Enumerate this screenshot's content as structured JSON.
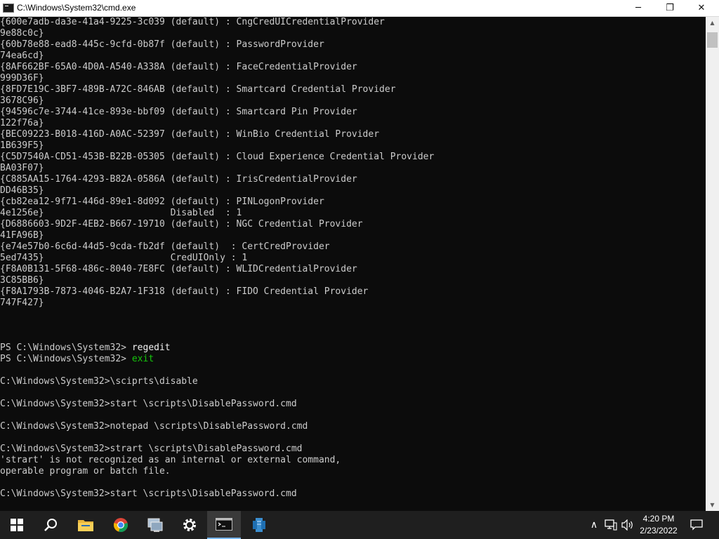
{
  "window": {
    "title": "C:\\Windows\\System32\\cmd.exe",
    "minimize_glyph": "─",
    "maximize_glyph": "❐",
    "close_glyph": "✕"
  },
  "console": {
    "lines": [
      {
        "text": "{600e7adb-da3e-41a4-9225-3c039 (default) : CngCredUICredentialProvider"
      },
      {
        "text": "9e88c0c}"
      },
      {
        "text": "{60b78e88-ead8-445c-9cfd-0b87f (default) : PasswordProvider"
      },
      {
        "text": "74ea6cd}"
      },
      {
        "text": "{8AF662BF-65A0-4D0A-A540-A338A (default) : FaceCredentialProvider"
      },
      {
        "text": "999D36F}"
      },
      {
        "text": "{8FD7E19C-3BF7-489B-A72C-846AB (default) : Smartcard Credential Provider"
      },
      {
        "text": "3678C96}"
      },
      {
        "text": "{94596c7e-3744-41ce-893e-bbf09 (default) : Smartcard Pin Provider"
      },
      {
        "text": "122f76a}"
      },
      {
        "text": "{BEC09223-B018-416D-A0AC-52397 (default) : WinBio Credential Provider"
      },
      {
        "text": "1B639F5}"
      },
      {
        "text": "{C5D7540A-CD51-453B-B22B-05305 (default) : Cloud Experience Credential Provider"
      },
      {
        "text": "BA03F07}"
      },
      {
        "text": "{C885AA15-1764-4293-B82A-0586A (default) : IrisCredentialProvider"
      },
      {
        "text": "DD46B35}"
      },
      {
        "text": "{cb82ea12-9f71-446d-89e1-8d092 (default) : PINLogonProvider"
      },
      {
        "text": "4e1256e}                       Disabled  : 1"
      },
      {
        "text": "{D6886603-9D2F-4EB2-B667-19710 (default) : NGC Credential Provider"
      },
      {
        "text": "41FA96B}"
      },
      {
        "text": "{e74e57b0-6c6d-44d5-9cda-fb2df (default)  : CertCredProvider"
      },
      {
        "text": "5ed7435}                       CredUIOnly : 1"
      },
      {
        "text": "{F8A0B131-5F68-486c-8040-7E8FC (default) : WLIDCredentialProvider"
      },
      {
        "text": "3C85BB6}"
      },
      {
        "text": "{F8A1793B-7873-4046-B2A7-1F318 (default) : FIDO Credential Provider"
      },
      {
        "text": "747F427}"
      },
      {
        "text": ""
      },
      {
        "text": ""
      },
      {
        "text": ""
      },
      {
        "text": "PS C:\\Windows\\System32> ",
        "cmd": "regedit"
      },
      {
        "text": "PS C:\\Windows\\System32> ",
        "exit": "exit"
      },
      {
        "text": ""
      },
      {
        "text": "C:\\Windows\\System32>\\sciprts\\disable"
      },
      {
        "text": ""
      },
      {
        "text": "C:\\Windows\\System32>start \\scripts\\DisablePassword.cmd"
      },
      {
        "text": ""
      },
      {
        "text": "C:\\Windows\\System32>notepad \\scripts\\DisablePassword.cmd"
      },
      {
        "text": ""
      },
      {
        "text": "C:\\Windows\\System32>strart \\scripts\\DisablePassword.cmd"
      },
      {
        "text": "'strart' is not recognized as an internal or external command,"
      },
      {
        "text": "operable program or batch file."
      },
      {
        "text": ""
      },
      {
        "text": "C:\\Windows\\System32>start \\scripts\\DisablePassword.cmd"
      },
      {
        "text": ""
      },
      {
        "text": "C:\\Windows\\System32>"
      }
    ]
  },
  "taskbar": {
    "apps": [
      {
        "name": "start-button",
        "icon": "windows-icon"
      },
      {
        "name": "search-button",
        "icon": "search-icon"
      },
      {
        "name": "file-explorer-button",
        "icon": "folder-icon"
      },
      {
        "name": "chrome-button",
        "icon": "chrome-icon"
      },
      {
        "name": "network-app-button",
        "icon": "computer-icon"
      },
      {
        "name": "settings-button",
        "icon": "gear-icon"
      },
      {
        "name": "cmd-button",
        "icon": "terminal-icon",
        "active": true
      },
      {
        "name": "server-manager-button",
        "icon": "server-icon"
      }
    ],
    "tray": {
      "chevron_glyph": "∧",
      "speaker_glyph": "🔊",
      "time": "4:20 PM",
      "date": "2/23/2022"
    }
  },
  "colors": {
    "console_bg": "#0c0c0c",
    "console_text": "#cccccc",
    "command_text": "#f2f2f2",
    "exit_text": "#16c60c",
    "taskbar_bg": "#1f1f1f",
    "taskbar_accent": "#7ab8f5"
  }
}
